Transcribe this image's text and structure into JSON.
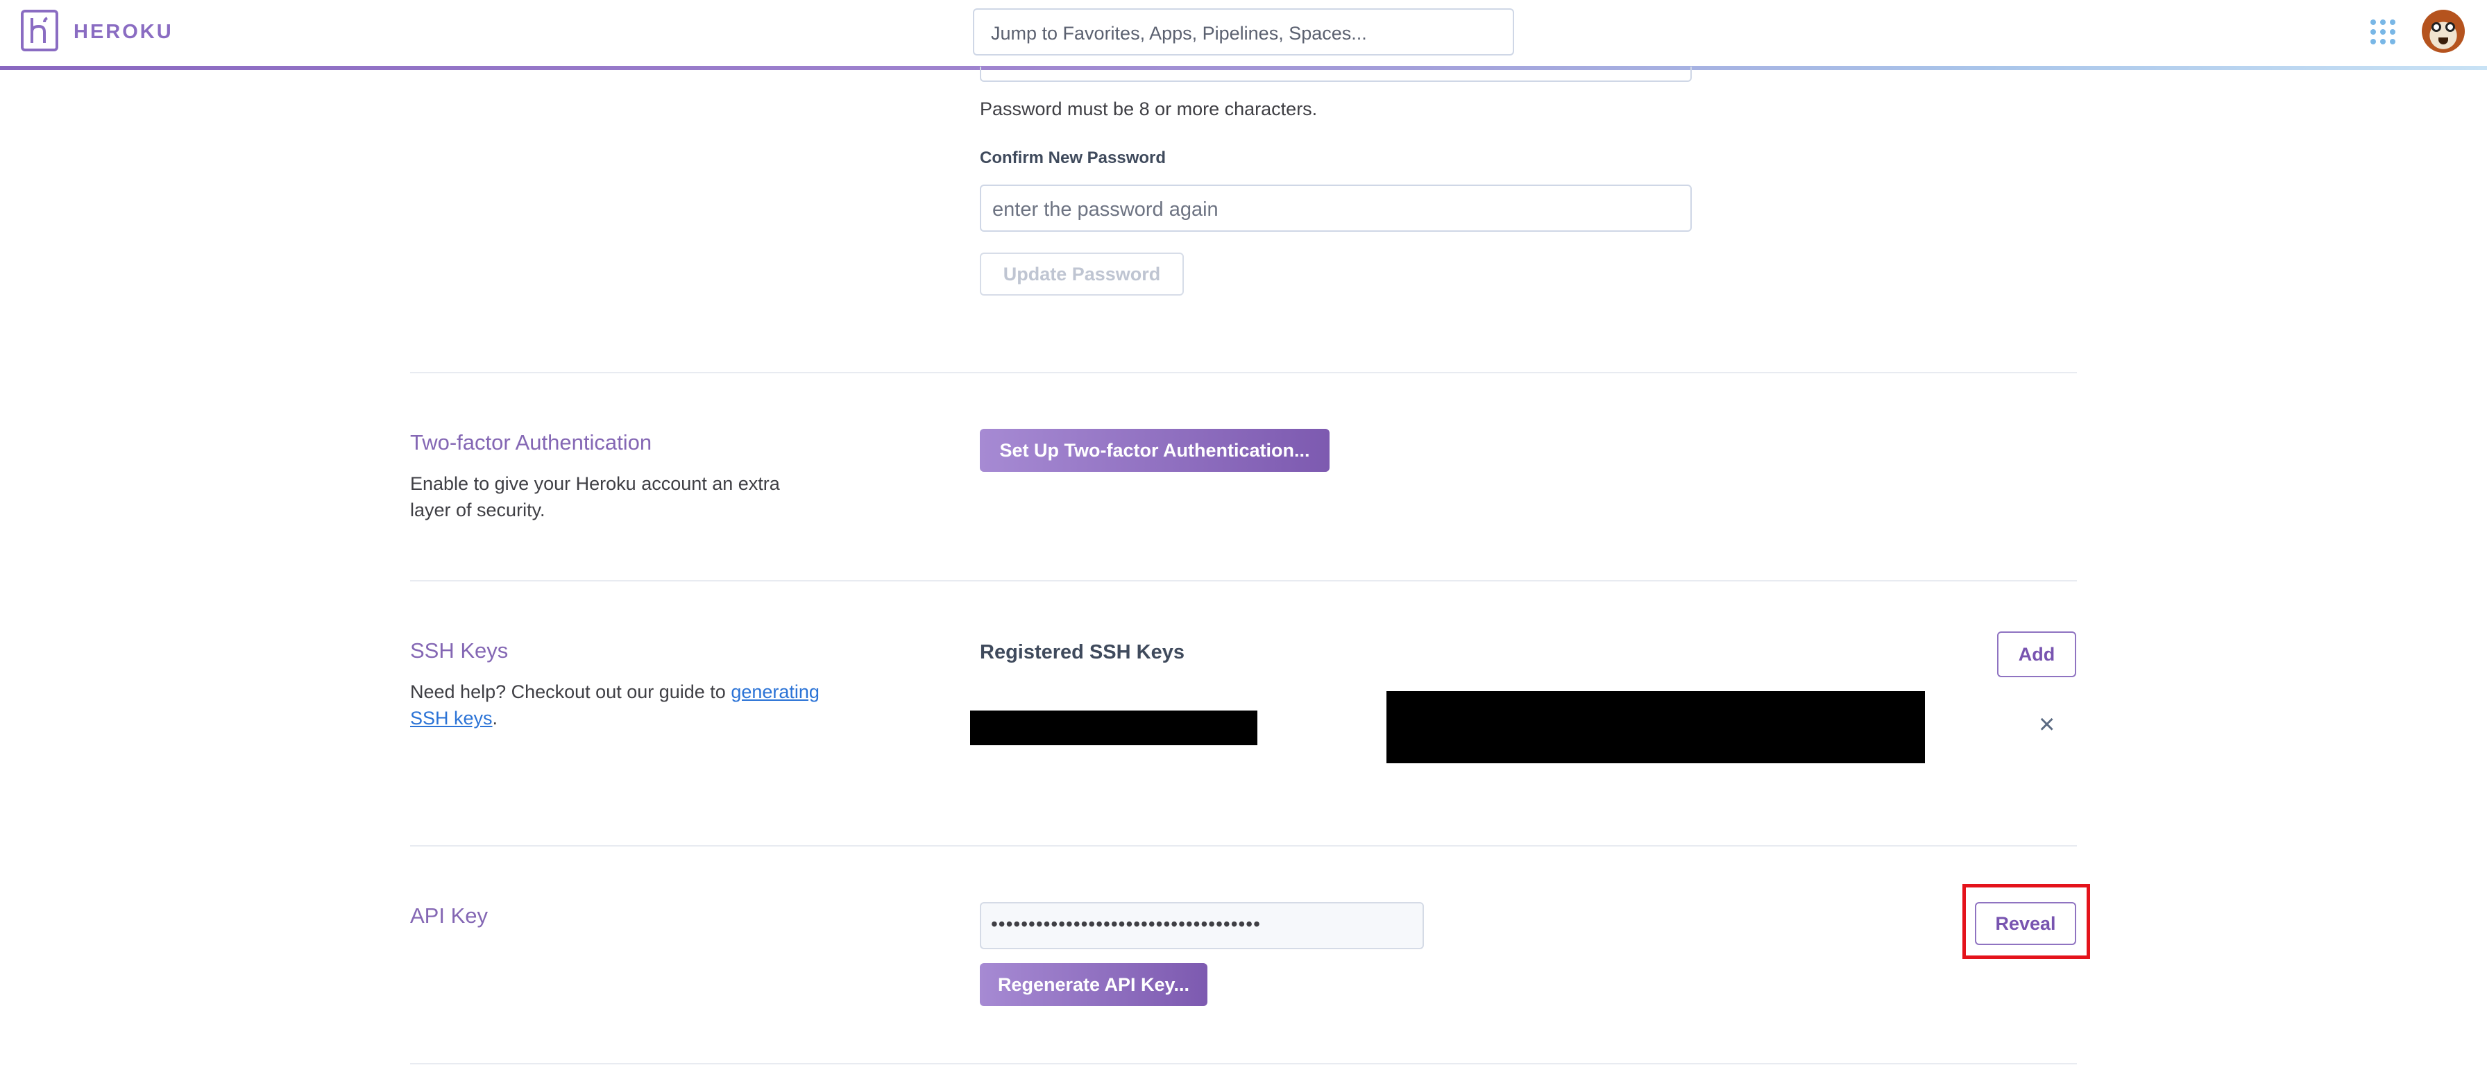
{
  "header": {
    "brand": "HEROKU",
    "search_placeholder": "Jump to Favorites, Apps, Pipelines, Spaces..."
  },
  "password": {
    "hint": "Password must be 8 or more characters.",
    "confirm_label": "Confirm New Password",
    "confirm_placeholder": "enter the password again",
    "update_button": "Update Password"
  },
  "two_factor": {
    "title": "Two-factor Authentication",
    "description": "Enable to give your Heroku account an extra layer of security.",
    "setup_button": "Set Up Two-factor Authentication..."
  },
  "ssh_keys": {
    "title": "SSH Keys",
    "description_prefix": "Need help? Checkout out our guide to ",
    "guide_link": "generating SSH keys",
    "description_suffix": ".",
    "registered_heading": "Registered SSH Keys",
    "add_button": "Add",
    "remove_icon": "×"
  },
  "api_key": {
    "title": "API Key",
    "masked_value": "••••••••••••••••••••••••••••••••••••",
    "reveal_button": "Reveal",
    "regenerate_button": "Regenerate API Key..."
  },
  "colors": {
    "brand_purple": "#8a6cc2",
    "highlight_red": "#e4131b",
    "link_blue": "#2b73d6"
  }
}
